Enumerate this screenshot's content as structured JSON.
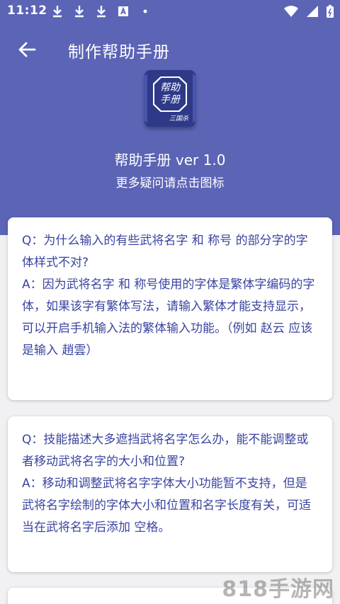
{
  "status_bar": {
    "time": "11:12",
    "left_icons": [
      "download-icon",
      "download-icon",
      "download-icon",
      "app-a-icon",
      "dot-icon"
    ],
    "right_icons": [
      "wifi-icon",
      "signal-icon",
      "battery-icon"
    ]
  },
  "app_bar": {
    "title": "制作帮助手册",
    "back_icon": "arrow-left-icon"
  },
  "app_icon": {
    "line1": "帮助",
    "line2": "手册",
    "signature": "三国杀"
  },
  "header": {
    "name": "帮助手册 ver 1.0",
    "subtitle": "更多疑问请点击图标"
  },
  "faq": [
    {
      "question": "Q：为什么输入的有些武将名字 和 称号 的部分字的字体样式不对?",
      "answer": "A：因为武将名字 和 称号使用的字体是繁体字编码的字体，如果该字有繁体写法，请输入繁体才能支持显示，可以开启手机输入法的繁体输入功能。（例如 赵云 应该是输入 趙雲）"
    },
    {
      "question": "Q：技能描述大多遮挡武将名字怎么办，能不能调整或者移动武将名字的大小和位置?",
      "answer": "A：移动和调整武将名字字体大小功能暂不支持，但是武将名字绘制的字体大小和位置和名字长度有关，可适当在武将名字后添加 空格。"
    }
  ],
  "watermark": "818手游网",
  "colors": {
    "header": "#5c64b6",
    "text_accent": "#3a44a0",
    "icon_bg": "#2e3a88",
    "background": "#f1f1f4"
  }
}
